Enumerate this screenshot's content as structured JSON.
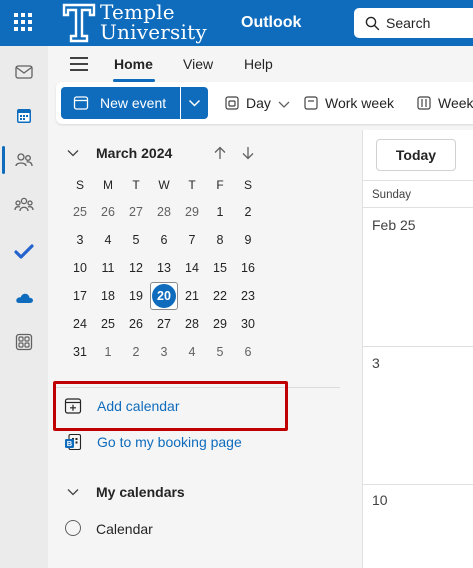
{
  "header": {
    "logo_line1": "Temple",
    "logo_line2": "University",
    "app_name": "Outlook",
    "search_placeholder": "Search",
    "brand_color": "#0f6cbd"
  },
  "rail": {
    "icons": [
      "mail-icon",
      "calendar-icon",
      "people-icon",
      "groups-icon",
      "todo-icon",
      "onedrive-icon",
      "apps-icon"
    ],
    "active": "calendar-icon"
  },
  "tabs": [
    {
      "label": "Home",
      "active": true
    },
    {
      "label": "View",
      "active": false
    },
    {
      "label": "Help",
      "active": false
    }
  ],
  "toolbar": {
    "new_event": "New event",
    "day": "Day",
    "work_week": "Work week",
    "week": "Week"
  },
  "mini_calendar": {
    "month_label": "March 2024",
    "weekday_headers": [
      "S",
      "M",
      "T",
      "W",
      "T",
      "F",
      "S"
    ],
    "weeks": [
      [
        "25",
        "26",
        "27",
        "28",
        "29",
        "1",
        "2"
      ],
      [
        "3",
        "4",
        "5",
        "6",
        "7",
        "8",
        "9"
      ],
      [
        "10",
        "11",
        "12",
        "13",
        "14",
        "15",
        "16"
      ],
      [
        "17",
        "18",
        "19",
        "20",
        "21",
        "22",
        "23"
      ],
      [
        "24",
        "25",
        "26",
        "27",
        "28",
        "29",
        "30"
      ],
      [
        "31",
        "1",
        "2",
        "3",
        "4",
        "5",
        "6"
      ]
    ],
    "today": "20"
  },
  "links": {
    "add_calendar": "Add calendar",
    "booking_page": "Go to my booking page"
  },
  "my_calendars": {
    "section_label": "My calendars",
    "items": [
      {
        "name": "Calendar"
      }
    ]
  },
  "main": {
    "today_button": "Today",
    "column_header": "Sunday",
    "cells": [
      "Feb 25",
      "3",
      "10"
    ]
  }
}
